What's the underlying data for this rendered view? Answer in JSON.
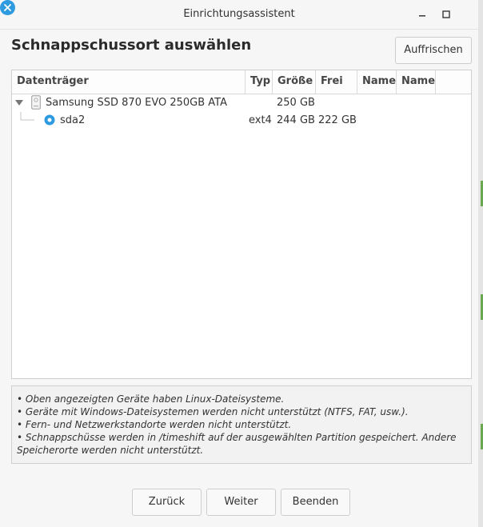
{
  "window": {
    "title": "Einrichtungsassistent"
  },
  "header": {
    "title": "Schnappschussort auswählen",
    "refresh_label": "Auffrischen"
  },
  "table": {
    "columns": [
      "Datenträger",
      "Typ",
      "Größe",
      "Frei",
      "Name",
      "Name"
    ],
    "disk": {
      "name": "Samsung SSD 870 EVO 250GB ATA",
      "type": "",
      "size": "250 GB",
      "free": ""
    },
    "partition": {
      "name": "sda2",
      "type": "ext4",
      "size": "244 GB",
      "free": "222 GB",
      "selected": true
    }
  },
  "info": {
    "lines": [
      "• Oben angezeigten Geräte haben Linux-Dateisysteme.",
      "• Geräte mit Windows-Dateisystemen werden nicht unterstützt (NTFS, FAT, usw.).",
      "• Fern- und Netzwerkstandorte werden nicht unterstützt.",
      "• Schnappschüsse werden in /timeshift auf der ausgewählten Partition gespeichert. Andere Speicherorte werden nicht unterstützt."
    ]
  },
  "footer": {
    "back_label": "Zurück",
    "next_label": "Weiter",
    "finish_label": "Beenden"
  },
  "colors": {
    "accent": "#2e9be0",
    "side_marker": "#6aa84f"
  }
}
